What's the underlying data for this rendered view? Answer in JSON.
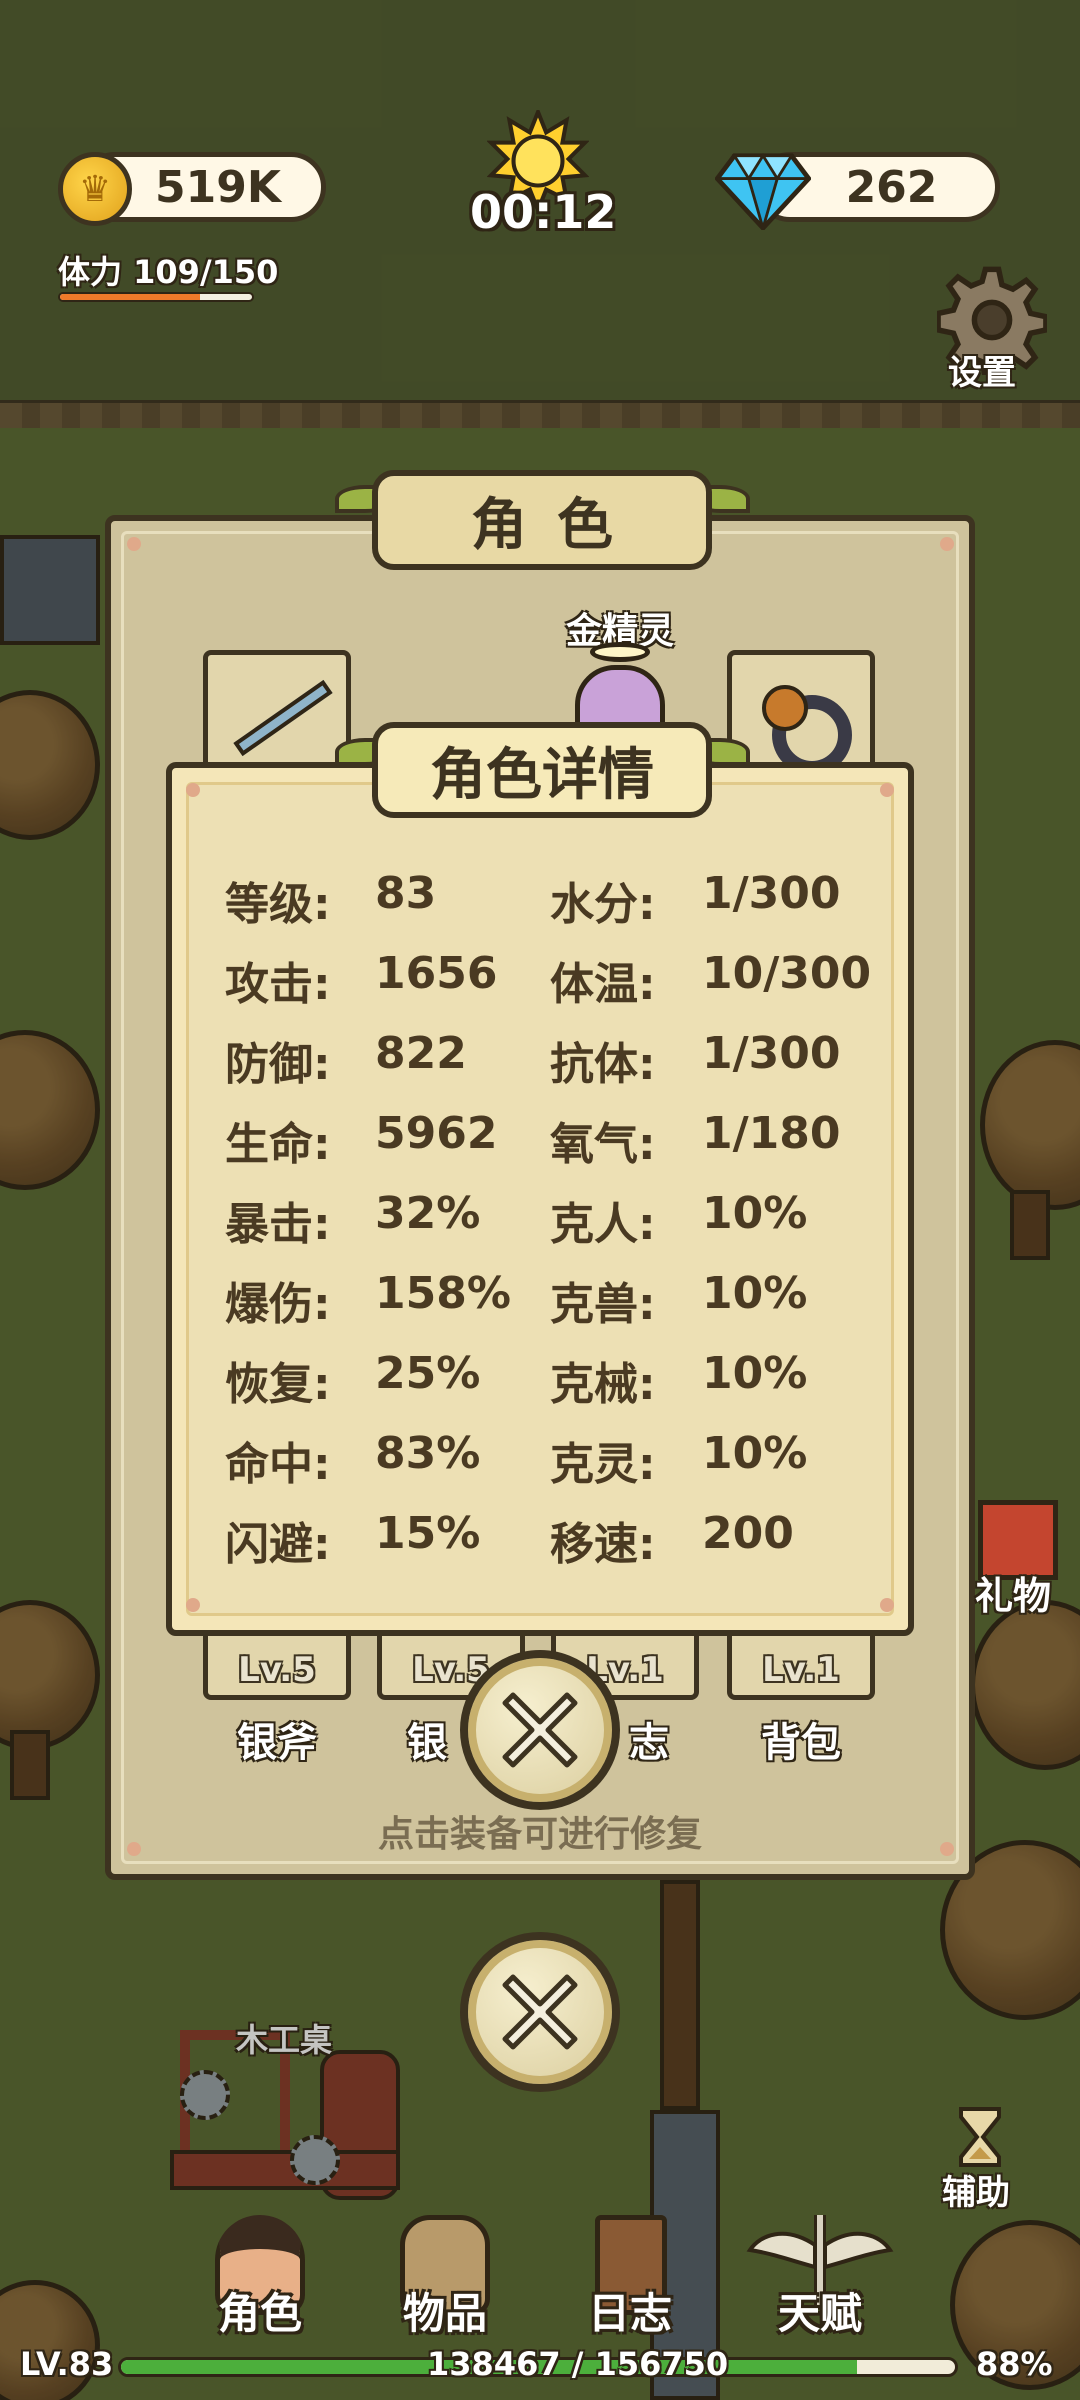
{
  "hud": {
    "coins": "519K",
    "gems": "262",
    "timer": "00:12",
    "stamina_label": "体力 109/150",
    "stamina_fraction": 0.727,
    "settings_label": "设置"
  },
  "character_panel": {
    "title": "角色",
    "companion_name": "金精灵",
    "repair_hint": "点击装备可进行修复",
    "equipment": [
      {
        "level": "Lv.5",
        "name": "银斧"
      },
      {
        "level": "Lv.5",
        "name": "银"
      },
      {
        "level": "Lv.1",
        "name": "志"
      },
      {
        "level": "Lv.1",
        "name": "背包"
      }
    ]
  },
  "detail": {
    "title": "角色详情",
    "left_stats": [
      {
        "label": "等级:",
        "value": "83"
      },
      {
        "label": "攻击:",
        "value": "1656"
      },
      {
        "label": "防御:",
        "value": "822"
      },
      {
        "label": "生命:",
        "value": "5962"
      },
      {
        "label": "暴击:",
        "value": "32%"
      },
      {
        "label": "爆伤:",
        "value": "158%"
      },
      {
        "label": "恢复:",
        "value": "25%"
      },
      {
        "label": "命中:",
        "value": "83%"
      },
      {
        "label": "闪避:",
        "value": "15%"
      }
    ],
    "right_stats": [
      {
        "label": "水分:",
        "value": "1/300"
      },
      {
        "label": "体温:",
        "value": "10/300"
      },
      {
        "label": "抗体:",
        "value": "1/300"
      },
      {
        "label": "氧气:",
        "value": "1/180"
      },
      {
        "label": "克人:",
        "value": "10%"
      },
      {
        "label": "克兽:",
        "value": "10%"
      },
      {
        "label": "克械:",
        "value": "10%"
      },
      {
        "label": "克灵:",
        "value": "10%"
      },
      {
        "label": "移速:",
        "value": "200"
      }
    ]
  },
  "world": {
    "workbench_label": "木工桌",
    "assist_label": "辅助",
    "gift_label": "礼物"
  },
  "nav": {
    "items": [
      {
        "label": "角色",
        "icon": "character-icon"
      },
      {
        "label": "物品",
        "icon": "backpack-icon"
      },
      {
        "label": "日志",
        "icon": "journal-icon"
      },
      {
        "label": "天赋",
        "icon": "talent-wings-icon"
      }
    ]
  },
  "footer": {
    "level": "LV.83",
    "xp": "138467 / 156750",
    "xp_percent": "88%",
    "xp_fraction": 0.883
  }
}
